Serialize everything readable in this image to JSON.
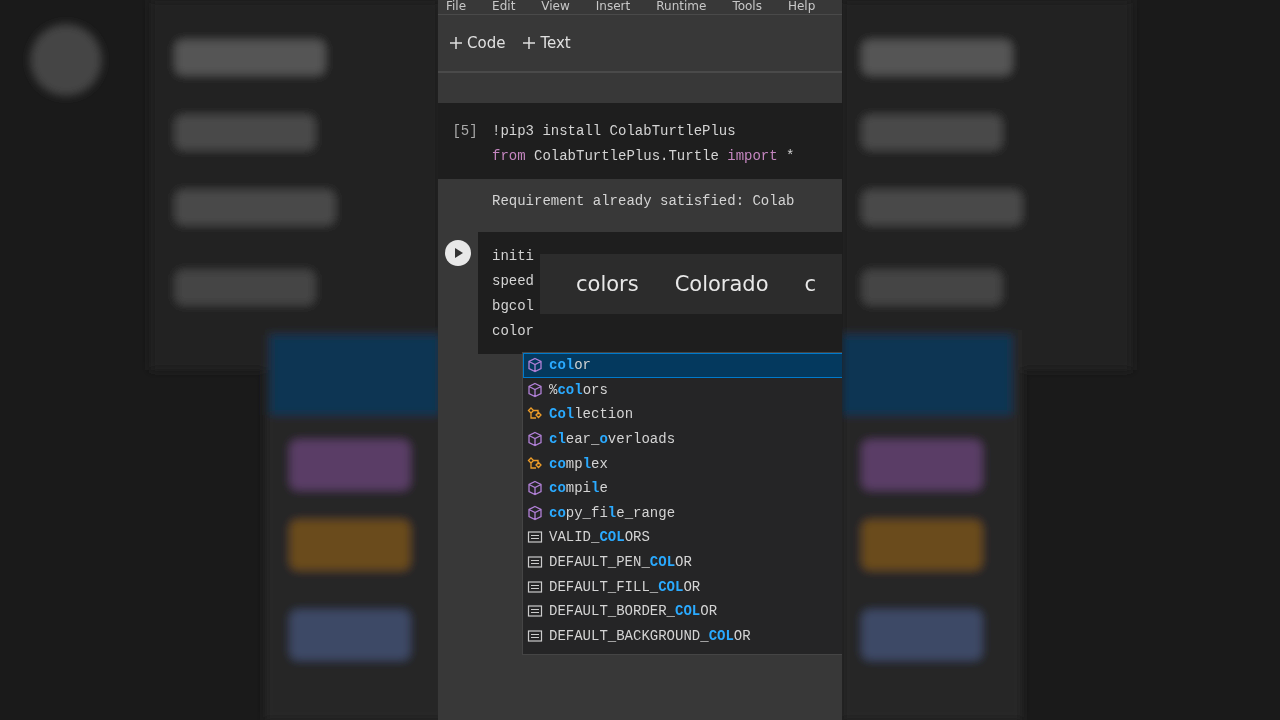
{
  "menu": [
    "File",
    "Edit",
    "View",
    "Insert",
    "Runtime",
    "Tools",
    "Help"
  ],
  "toolbar": [
    {
      "label": "Code"
    },
    {
      "label": "Text"
    }
  ],
  "cells": [
    {
      "kind": "executed",
      "count": "[5]",
      "lines": [
        [
          {
            "text": "!pip3 install ColabTurtlePlus",
            "keyword": false
          }
        ],
        [
          {
            "text": "from",
            "keyword": true
          },
          {
            "text": " ColabTurtlePlus.Turtle ",
            "keyword": false
          },
          {
            "text": "import",
            "keyword": true
          },
          {
            "text": " *",
            "keyword": false
          }
        ]
      ],
      "output": "Requirement already satisfied: Colab"
    },
    {
      "kind": "editing",
      "lines": [
        [
          {
            "text": "initi",
            "keyword": false
          }
        ],
        [
          {
            "text": "speed",
            "keyword": false
          }
        ],
        [
          {
            "text": "bgcol",
            "keyword": false
          }
        ],
        [
          {
            "text": "color",
            "keyword": false
          }
        ]
      ]
    }
  ],
  "suggestions": [
    "colors",
    "Colorado",
    "c"
  ],
  "completions": [
    {
      "kind": "method",
      "selected": true,
      "segments": [
        {
          "text": "col",
          "match": true
        },
        {
          "text": "or",
          "match": false
        }
      ]
    },
    {
      "kind": "method",
      "selected": false,
      "segments": [
        {
          "text": "%",
          "match": false
        },
        {
          "text": "col",
          "match": true
        },
        {
          "text": "ors",
          "match": false
        }
      ]
    },
    {
      "kind": "class",
      "selected": false,
      "segments": [
        {
          "text": "Col",
          "match": true
        },
        {
          "text": "lection",
          "match": false
        }
      ]
    },
    {
      "kind": "method",
      "selected": false,
      "segments": [
        {
          "text": "cl",
          "match": true
        },
        {
          "text": "ear_",
          "match": false
        },
        {
          "text": "o",
          "match": true
        },
        {
          "text": "verloads",
          "match": false
        }
      ]
    },
    {
      "kind": "class",
      "selected": false,
      "segments": [
        {
          "text": "co",
          "match": true
        },
        {
          "text": "mp",
          "match": false
        },
        {
          "text": "l",
          "match": true
        },
        {
          "text": "ex",
          "match": false
        }
      ]
    },
    {
      "kind": "method",
      "selected": false,
      "segments": [
        {
          "text": "co",
          "match": true
        },
        {
          "text": "mpi",
          "match": false
        },
        {
          "text": "l",
          "match": true
        },
        {
          "text": "e",
          "match": false
        }
      ]
    },
    {
      "kind": "method",
      "selected": false,
      "segments": [
        {
          "text": "co",
          "match": true
        },
        {
          "text": "py_fi",
          "match": false
        },
        {
          "text": "l",
          "match": true
        },
        {
          "text": "e_range",
          "match": false
        }
      ]
    },
    {
      "kind": "field",
      "selected": false,
      "segments": [
        {
          "text": "VALID_",
          "match": false
        },
        {
          "text": "COL",
          "match": true
        },
        {
          "text": "ORS",
          "match": false
        }
      ]
    },
    {
      "kind": "field",
      "selected": false,
      "segments": [
        {
          "text": "DEFAULT_PEN_",
          "match": false
        },
        {
          "text": "COL",
          "match": true
        },
        {
          "text": "OR",
          "match": false
        }
      ]
    },
    {
      "kind": "field",
      "selected": false,
      "segments": [
        {
          "text": "DEFAULT_FILL_",
          "match": false
        },
        {
          "text": "COL",
          "match": true
        },
        {
          "text": "OR",
          "match": false
        }
      ]
    },
    {
      "kind": "field",
      "selected": false,
      "segments": [
        {
          "text": "DEFAULT_BORDER_",
          "match": false
        },
        {
          "text": "COL",
          "match": true
        },
        {
          "text": "OR",
          "match": false
        }
      ]
    },
    {
      "kind": "field",
      "selected": false,
      "segments": [
        {
          "text": "DEFAULT_BACKGROUND_",
          "match": false
        },
        {
          "text": "COL",
          "match": true
        },
        {
          "text": "OR",
          "match": false
        }
      ]
    }
  ]
}
